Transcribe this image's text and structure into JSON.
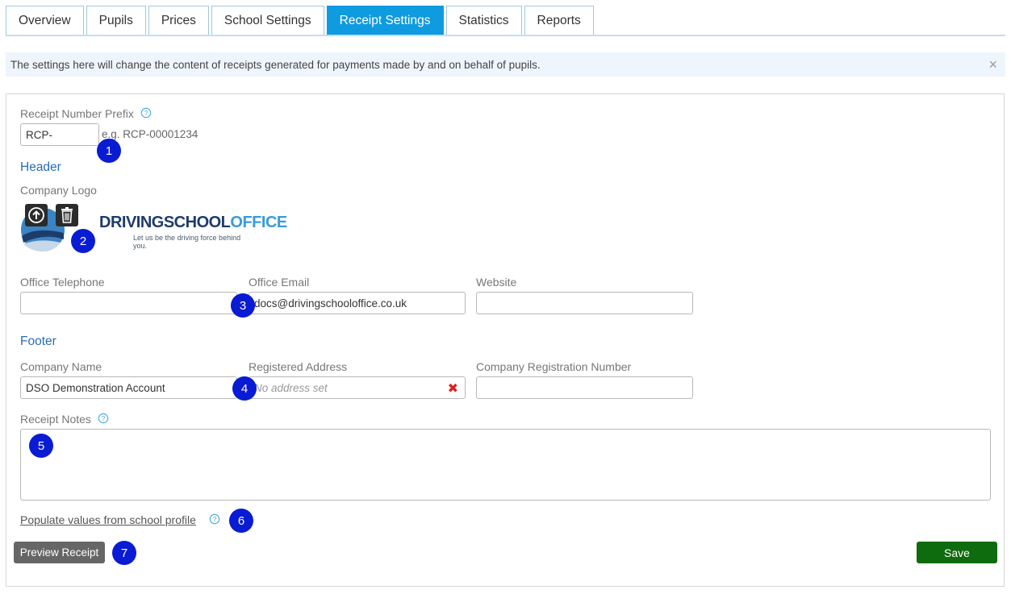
{
  "tabs": [
    "Overview",
    "Pupils",
    "Prices",
    "School Settings",
    "Receipt Settings",
    "Statistics",
    "Reports"
  ],
  "active_tab": "Receipt Settings",
  "info_text": "The settings here will change the content of receipts generated for payments made by and on behalf of pupils.",
  "info_close": "×",
  "receipt_prefix": {
    "label": "Receipt Number Prefix",
    "value": "RCP-",
    "example": "e.g. RCP-00001234"
  },
  "header": {
    "title": "Header",
    "logo_label": "Company Logo",
    "logo_brand_main": "DRIVINGSCHOOL",
    "logo_brand_accent": "OFFICE",
    "logo_tagline": "Let us be the driving force behind you."
  },
  "contact": {
    "telephone_label": "Office Telephone",
    "telephone_value": "",
    "email_label": "Office Email",
    "email_value": "docs@drivingschooloffice.co.uk",
    "website_label": "Website",
    "website_value": ""
  },
  "footer": {
    "title": "Footer",
    "company_name_label": "Company Name",
    "company_name_value": "DSO Demonstration Account",
    "address_label": "Registered Address",
    "address_placeholder": "No address set",
    "reg_number_label": "Company Registration Number",
    "reg_number_value": ""
  },
  "notes": {
    "label": "Receipt Notes",
    "value": ""
  },
  "populate_link": "Populate values from school profile",
  "buttons": {
    "preview": "Preview Receipt",
    "save": "Save"
  },
  "badges": [
    "1",
    "2",
    "3",
    "4",
    "5",
    "6",
    "7"
  ],
  "colors": {
    "active_tab": "#0e9be0",
    "section_title": "#2a6db5",
    "save_button": "#0e6b0e",
    "preview_button": "#666666",
    "badge": "#0a1bd4",
    "clear_icon": "#e02020"
  }
}
